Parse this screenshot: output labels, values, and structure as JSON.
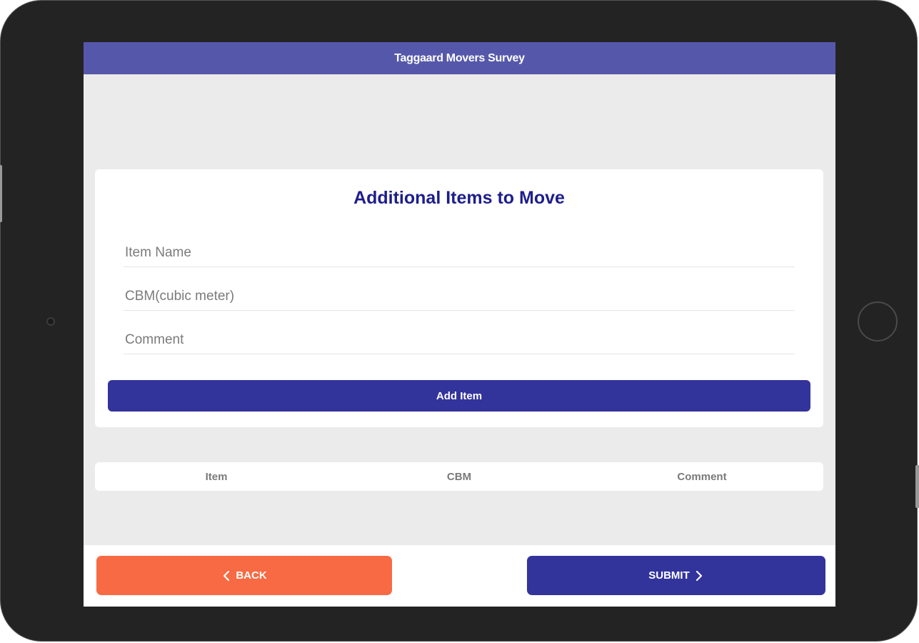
{
  "app": {
    "title": "Taggaard Movers Survey"
  },
  "card": {
    "title": "Additional Items to Move",
    "fields": {
      "item_name": {
        "placeholder": "Item Name",
        "value": ""
      },
      "cbm": {
        "placeholder": "CBM(cubic meter)",
        "value": ""
      },
      "comment": {
        "placeholder": "Comment",
        "value": ""
      }
    },
    "add_button_label": "Add Item"
  },
  "table": {
    "columns": [
      "Item",
      "CBM",
      "Comment"
    ],
    "rows": []
  },
  "footer": {
    "back_label": "BACK",
    "submit_label": "SUBMIT"
  },
  "colors": {
    "header_bg": "#5558aa",
    "primary": "#33339c",
    "back_button": "#f76a43",
    "title_text": "#1e1e8c",
    "screen_bg": "#ebebeb"
  },
  "icons": {
    "back": "chevron-left-icon",
    "submit": "chevron-right-icon"
  }
}
